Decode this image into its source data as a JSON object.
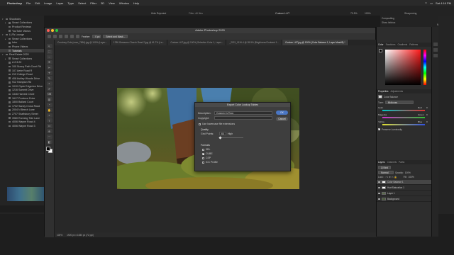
{
  "menubar": {
    "items": [
      "Photoshop",
      "File",
      "Edit",
      "Image",
      "Layer",
      "Type",
      "Select",
      "Filter",
      "3D",
      "View",
      "Window",
      "Help"
    ],
    "right_text": "Sat 4:16 PM"
  },
  "lightroom": {
    "center_status": "Hide Rejected",
    "center_subtitle": "Filter: All files",
    "preset_title": "Custom LUT",
    "zoom": "70.5%",
    "zoom2": "100%",
    "right_header": "Sharpening",
    "right_labels": [
      "Compositing",
      "Show Infobox",
      "Normal"
    ],
    "collections": [
      {
        "label": "Shootouts",
        "level": 0,
        "tri": "▾"
      },
      {
        "label": "Smart Collections",
        "level": 1,
        "tri": "▸"
      },
      {
        "label": "Product Reviews",
        "level": 1,
        "tri": ""
      },
      {
        "label": "YouTube Videos",
        "level": 1,
        "tri": ""
      },
      {
        "label": "LUTs Lounge",
        "level": 0,
        "tri": "▾"
      },
      {
        "label": "Smart Collections",
        "level": 1,
        "tri": "▸"
      },
      {
        "label": "Intro",
        "level": 1,
        "tri": ""
      },
      {
        "label": "Phone Videos",
        "level": 1,
        "tri": ""
      },
      {
        "label": "Tutorials",
        "level": 1,
        "tri": "",
        "selected": true
      },
      {
        "label": "Real Estate 2020",
        "level": 0,
        "tri": "▾"
      },
      {
        "label": "Smart Collections",
        "level": 1,
        "tri": "▸"
      },
      {
        "label": "A 2:3:20",
        "level": 1,
        "tri": ""
      },
      {
        "label": "100 Sunny Path Court Rd",
        "level": 1,
        "tri": ""
      },
      {
        "label": "107 Aerie Road R",
        "level": 1,
        "tri": ""
      },
      {
        "label": "219 College Road",
        "level": 1,
        "tri": ""
      },
      {
        "label": "408 Ashley Woods Drive",
        "level": 1,
        "tri": ""
      },
      {
        "label": "912 Hampton Rd",
        "level": 1,
        "tri": ""
      },
      {
        "label": "1010 Clyde Edgerton Drive",
        "level": 1,
        "tri": ""
      },
      {
        "label": "1216 Summit Drive",
        "level": 1,
        "tri": ""
      },
      {
        "label": "1346 Harvest Circle",
        "level": 1,
        "tri": ""
      },
      {
        "label": "1617 Province Drive",
        "level": 1,
        "tri": ""
      },
      {
        "label": "1800 Ballard Court",
        "level": 1,
        "tri": ""
      },
      {
        "label": "1702 Sandy Cross Road",
        "level": 1,
        "tri": ""
      },
      {
        "label": "2004 N Beech Lane",
        "level": 1,
        "tri": ""
      },
      {
        "label": "2707 Shaftsbury Street",
        "level": 1,
        "tri": ""
      },
      {
        "label": "3980 Running Tide Lane",
        "level": 1,
        "tri": ""
      },
      {
        "label": "4006 Wayne Road 4",
        "level": 1,
        "tri": ""
      },
      {
        "label": "4006 Wayne Road 3",
        "level": 1,
        "tri": ""
      }
    ]
  },
  "photoshop": {
    "window_title": "Adobe Photoshop 2020",
    "options": {
      "feather_label": "Feather:",
      "feather_value": "0 px",
      "refine_label": "Select and Mask..."
    },
    "tabs": [
      {
        "label": "Courtney Cole (cmm_7696).jpg @ 100% (Layer...",
        "active": false
      },
      {
        "label": "1786 Greasons Church Road 2.jpg @ 61.7% (La...",
        "active": false
      },
      {
        "label": "Custom LUT.jpg @ 100% (Selective Color 1, Layer...",
        "active": false
      },
      {
        "label": "_2021_0116-4 @ 55.5% (Brightness/Contrast 1...",
        "active": false
      },
      {
        "label": "Custom LUT.jpg @ 100% (Color Balance 1, Layer Mask/8) *",
        "active": true
      }
    ],
    "status_zoom": "100%",
    "status_doc": "1920 px x 1080 px (72 ppi)",
    "tool_glyphs": [
      "↖",
      "⬚",
      "◌",
      "⌗",
      "✂",
      "⌖",
      "✎",
      "◐",
      "✐",
      "⌫",
      "▥",
      "◔",
      "✋",
      "⌕",
      "T",
      "▭",
      "⊕",
      "⋯",
      "◧"
    ]
  },
  "dialog": {
    "title": "Export Color Lookup Tables",
    "description_label": "Description:",
    "description_value": "Custom LUT.jpg",
    "copyright_label": "Copyright:",
    "copyright_value": "",
    "lowercase_label": "Use lowercase file extensions",
    "quality_label": "Quality",
    "grid_points_label": "Grid Points:",
    "grid_points_value": "64",
    "grid_points_quality": "High",
    "formats_label": "Formats",
    "formats": [
      {
        "label": "3DL",
        "checked": false
      },
      {
        "label": "CUBE",
        "checked": true
      },
      {
        "label": "CSP",
        "checked": false
      },
      {
        "label": "ICC Profile",
        "checked": false
      }
    ],
    "ok_label": "OK",
    "cancel_label": "Cancel"
  },
  "panels": {
    "color_tabs": [
      "Color",
      "Swatches",
      "Gradients",
      "Patterns"
    ],
    "properties_tabs": [
      "Properties",
      "Adjustments"
    ],
    "properties_title": "Color Balance",
    "tone_label": "Tone:",
    "tone_value": "Midtones",
    "sliders": [
      {
        "left": "Cyan",
        "right": "Red",
        "value": "0",
        "color_left": "#00c8c8",
        "color_right": "#e03030"
      },
      {
        "left": "Magenta",
        "right": "Green",
        "value": "0",
        "color_left": "#d030d0",
        "color_right": "#30c030"
      },
      {
        "left": "Yellow",
        "right": "Blue",
        "value": "0",
        "color_left": "#e0e030",
        "color_right": "#3050e0"
      }
    ],
    "preserve_label": "Preserve Luminosity",
    "layers_tabs": [
      "Layers",
      "Channels",
      "Paths"
    ],
    "kind_label": "Q Kind",
    "blend_mode": "Normal",
    "opacity_label": "Opacity:",
    "opacity_value": "100%",
    "lock_label": "Lock:",
    "fill_label": "Fill:",
    "fill_value": "100%",
    "layers": [
      {
        "name": "Color Balance 1",
        "selected": true,
        "thumb": "#ffffff"
      },
      {
        "name": "Hue/Saturation 1",
        "selected": false,
        "thumb": "#ffffff"
      },
      {
        "name": "Layer 1",
        "selected": false,
        "thumb": "#5a6b4a"
      },
      {
        "name": "Background",
        "selected": false,
        "thumb": "#4a5b3a"
      }
    ],
    "fg_color": "#000000",
    "bg_color": "#ffffff",
    "picker_hue": "#ff1a1a"
  }
}
